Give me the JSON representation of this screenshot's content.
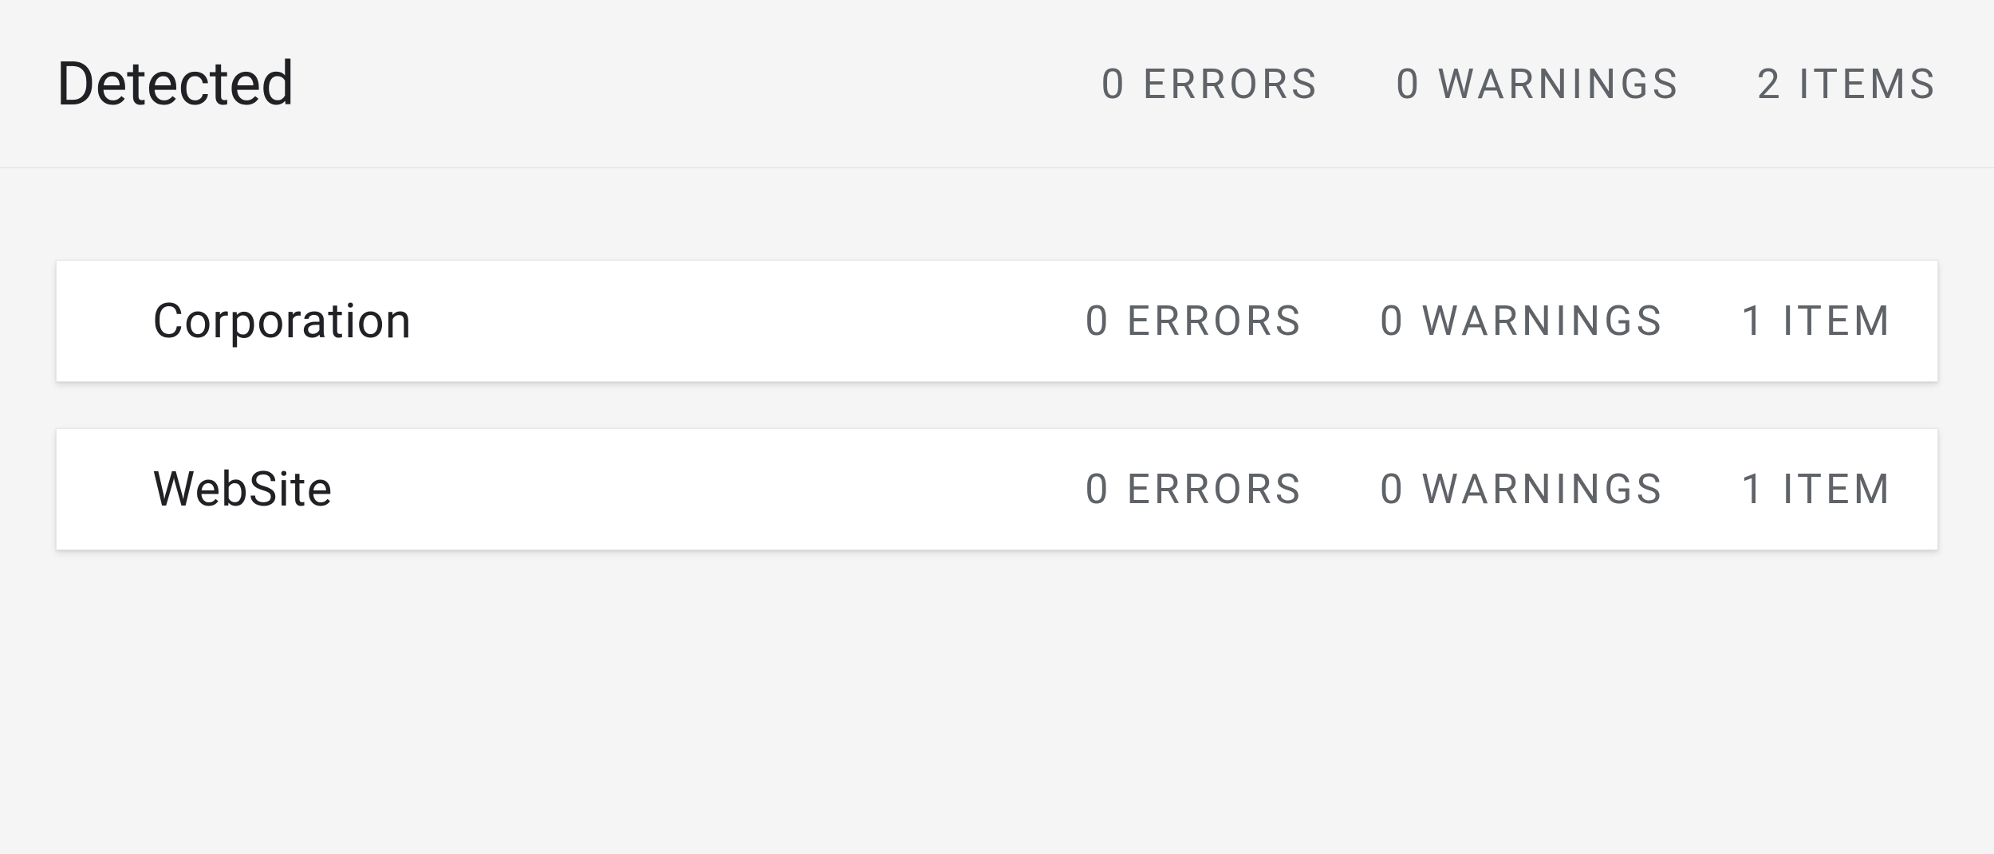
{
  "header": {
    "title": "Detected",
    "errors_label": "0 ERRORS",
    "warnings_label": "0 WARNINGS",
    "items_label": "2 ITEMS"
  },
  "items": [
    {
      "title": "Corporation",
      "errors_label": "0 ERRORS",
      "warnings_label": "0 WARNINGS",
      "items_label": "1 ITEM"
    },
    {
      "title": "WebSite",
      "errors_label": "0 ERRORS",
      "warnings_label": "0 WARNINGS",
      "items_label": "1 ITEM"
    }
  ]
}
